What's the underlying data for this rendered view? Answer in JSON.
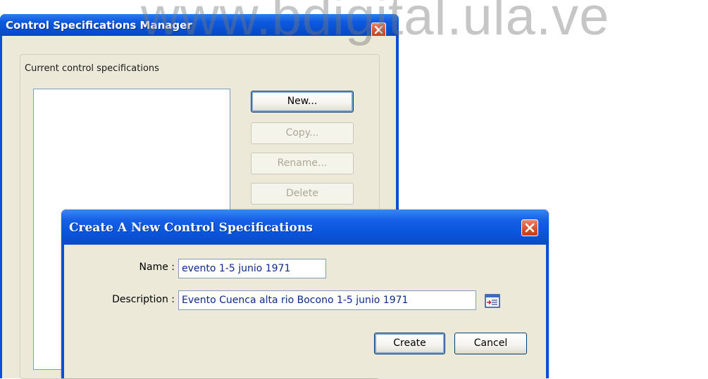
{
  "manager_window": {
    "title": "Control Specifications Manager",
    "group_label": "Current control specifications",
    "buttons": {
      "new": "New...",
      "copy": "Copy...",
      "rename": "Rename...",
      "delete": "Delete"
    },
    "list_items": []
  },
  "create_dialog": {
    "title": "Create A New Control Specifications",
    "name_label": "Name :",
    "name_value": "evento 1-5 junio 1971",
    "description_label": "Description :",
    "description_value": "Evento Cuenca alta rio Bocono 1-5 junio 1971",
    "browse_icon": "text-editor-icon",
    "create_label": "Create",
    "cancel_label": "Cancel"
  },
  "watermark": "www.bdigital.ula.ve",
  "colors": {
    "title_bar": "#0a55db",
    "close_button": "#d8532f",
    "dialog_face": "#ece9d8",
    "input_text": "#0b2a8c"
  }
}
